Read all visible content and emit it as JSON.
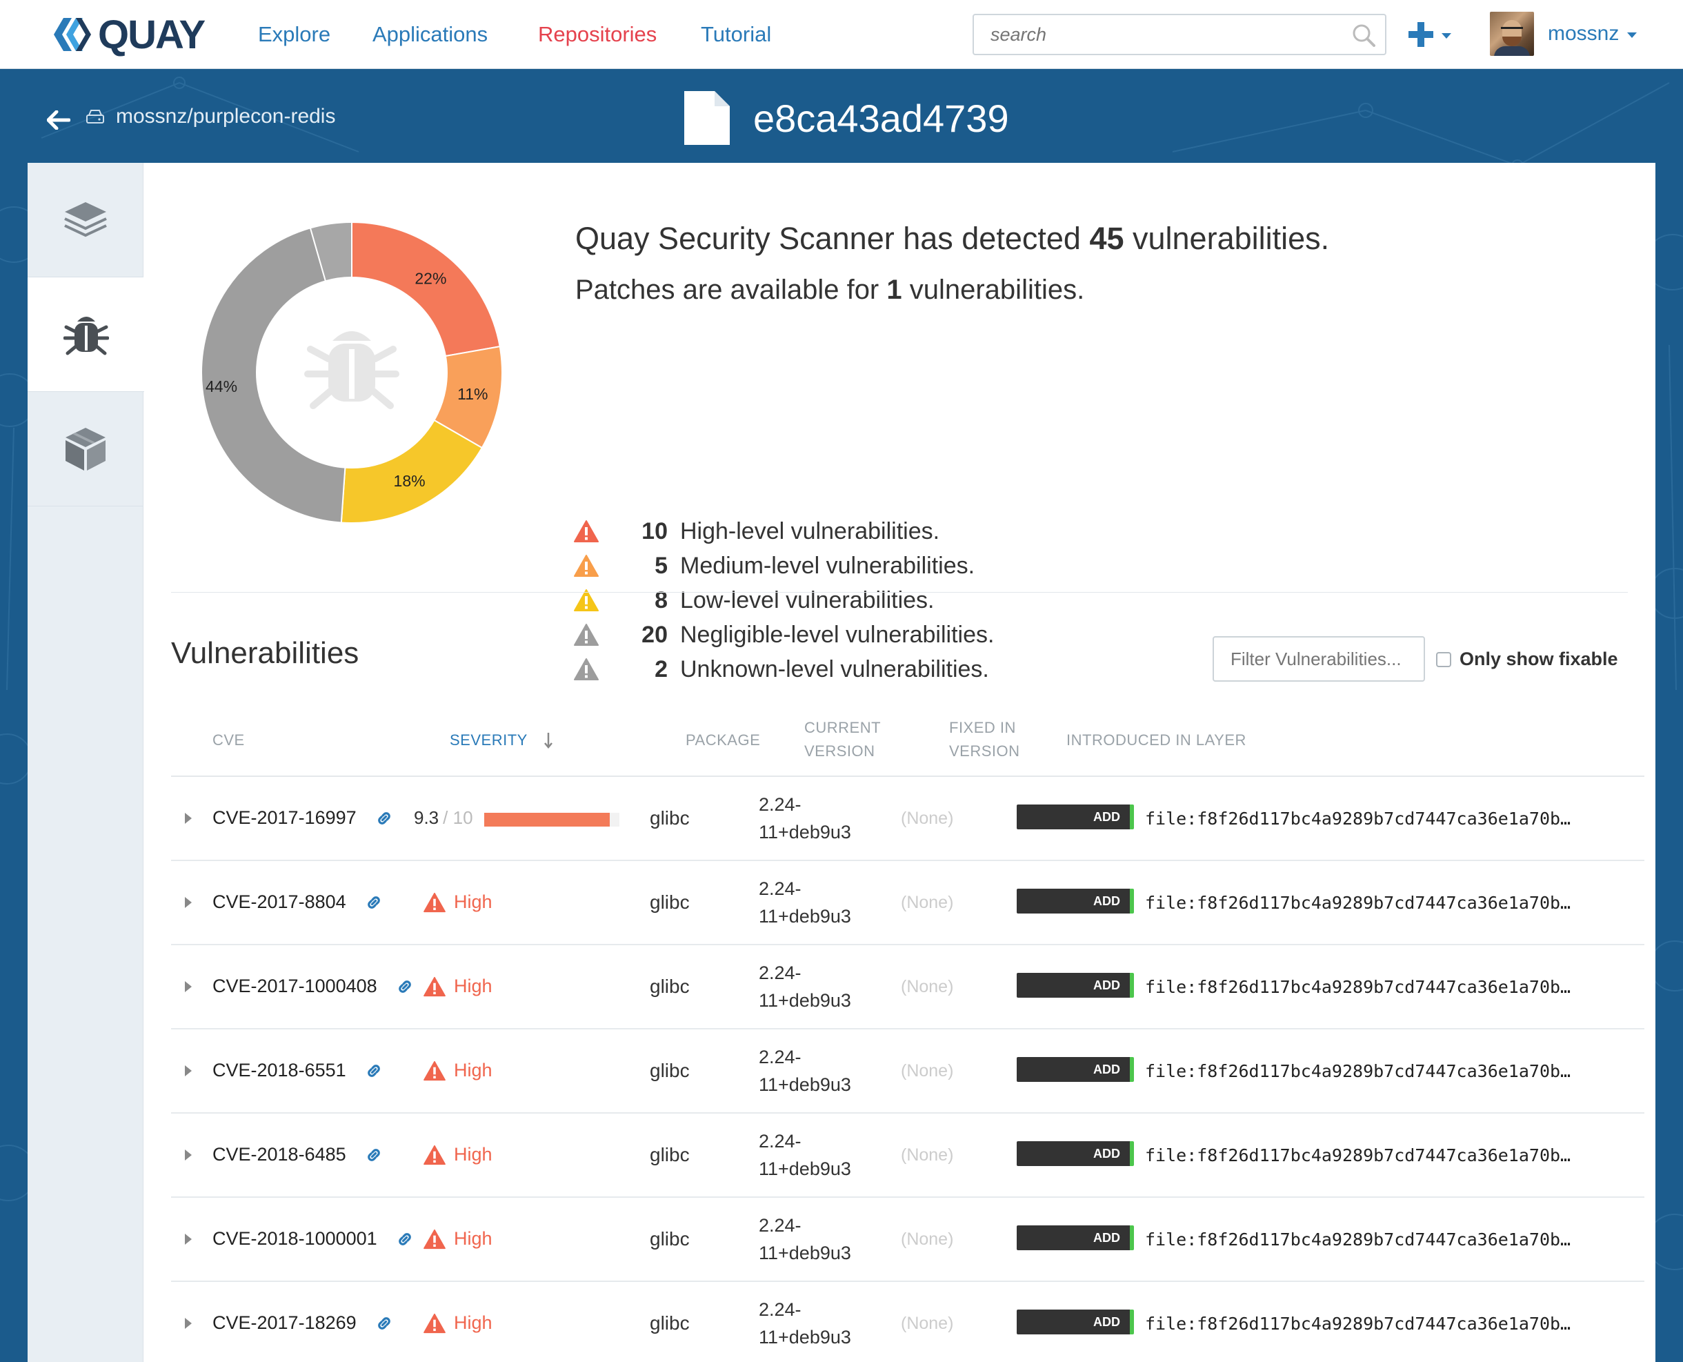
{
  "nav": {
    "logo_text": "QUAY",
    "links": [
      "Explore",
      "Applications",
      "Repositories",
      "Tutorial"
    ],
    "active_link": "Repositories",
    "search_placeholder": "search",
    "username": "mossnz"
  },
  "header": {
    "repo": "mossnz/purplecon-redis",
    "title": "e8ca43ad4739"
  },
  "sidebar": {
    "tabs": [
      {
        "name": "layers-tab",
        "icon": "layers-icon",
        "active": false
      },
      {
        "name": "security-tab",
        "icon": "bug-icon",
        "active": true
      },
      {
        "name": "packages-tab",
        "icon": "package-icon",
        "active": false
      }
    ]
  },
  "summary": {
    "line1_prefix": "Quay Security Scanner has detected ",
    "total": "45",
    "line1_suffix": " vulnerabilities.",
    "line2_prefix": "Patches are available for ",
    "fixable": "1",
    "line2_suffix": " vulnerabilities.",
    "levels": [
      {
        "count": "10",
        "label": "High-level vulnerabilities.",
        "color": "#f0654d"
      },
      {
        "count": "5",
        "label": "Medium-level vulnerabilities.",
        "color": "#f89e4a"
      },
      {
        "count": "8",
        "label": "Low-level vulnerabilities.",
        "color": "#f5c518"
      },
      {
        "count": "20",
        "label": "Negligible-level vulnerabilities.",
        "color": "#9d9d9d"
      },
      {
        "count": "2",
        "label": "Unknown-level vulnerabilities.",
        "color": "#9d9d9d"
      }
    ]
  },
  "chart_data": {
    "type": "pie",
    "labels": [
      "High",
      "Medium",
      "Low",
      "Negligible",
      "Unknown"
    ],
    "values": [
      10,
      5,
      8,
      20,
      2
    ],
    "percent_labels": [
      "22%",
      "11%",
      "18%",
      "44%",
      ""
    ],
    "colors": [
      "#f47959",
      "#f9a05a",
      "#f6c72a",
      "#9e9e9e",
      "#a7a7a7"
    ]
  },
  "vulnerabilities": {
    "title": "Vulnerabilities",
    "filter_placeholder": "Filter Vulnerabilities...",
    "only_fixable_label": "Only show fixable",
    "columns": {
      "cve": "CVE",
      "severity": "SEVERITY",
      "package": "PACKAGE",
      "current_version": "CURRENT\nVERSION",
      "fixed_in": "FIXED IN\nVERSION",
      "layer": "INTRODUCED IN LAYER"
    },
    "rows": [
      {
        "cve": "CVE-2017-16997",
        "score": "9.3",
        "score_of": "/ 10",
        "score_fraction": 0.93,
        "severity": "",
        "package": "glibc",
        "version_a": "2.24-",
        "version_b": "11+deb9u3",
        "fixed": "(None)",
        "layer_op": "ADD",
        "layer": "file:f8f26d117bc4a9289b7cd7447ca36e1a70b…"
      },
      {
        "cve": "CVE-2017-8804",
        "severity": "High",
        "package": "glibc",
        "version_a": "2.24-",
        "version_b": "11+deb9u3",
        "fixed": "(None)",
        "layer_op": "ADD",
        "layer": "file:f8f26d117bc4a9289b7cd7447ca36e1a70b…"
      },
      {
        "cve": "CVE-2017-1000408",
        "severity": "High",
        "package": "glibc",
        "version_a": "2.24-",
        "version_b": "11+deb9u3",
        "fixed": "(None)",
        "layer_op": "ADD",
        "layer": "file:f8f26d117bc4a9289b7cd7447ca36e1a70b…"
      },
      {
        "cve": "CVE-2018-6551",
        "severity": "High",
        "package": "glibc",
        "version_a": "2.24-",
        "version_b": "11+deb9u3",
        "fixed": "(None)",
        "layer_op": "ADD",
        "layer": "file:f8f26d117bc4a9289b7cd7447ca36e1a70b…"
      },
      {
        "cve": "CVE-2018-6485",
        "severity": "High",
        "package": "glibc",
        "version_a": "2.24-",
        "version_b": "11+deb9u3",
        "fixed": "(None)",
        "layer_op": "ADD",
        "layer": "file:f8f26d117bc4a9289b7cd7447ca36e1a70b…"
      },
      {
        "cve": "CVE-2018-1000001",
        "severity": "High",
        "package": "glibc",
        "version_a": "2.24-",
        "version_b": "11+deb9u3",
        "fixed": "(None)",
        "layer_op": "ADD",
        "layer": "file:f8f26d117bc4a9289b7cd7447ca36e1a70b…"
      },
      {
        "cve": "CVE-2017-18269",
        "severity": "High",
        "package": "glibc",
        "version_a": "2.24-",
        "version_b": "11+deb9u3",
        "fixed": "(None)",
        "layer_op": "ADD",
        "layer": "file:f8f26d117bc4a9289b7cd7447ca36e1a70b…"
      }
    ]
  }
}
